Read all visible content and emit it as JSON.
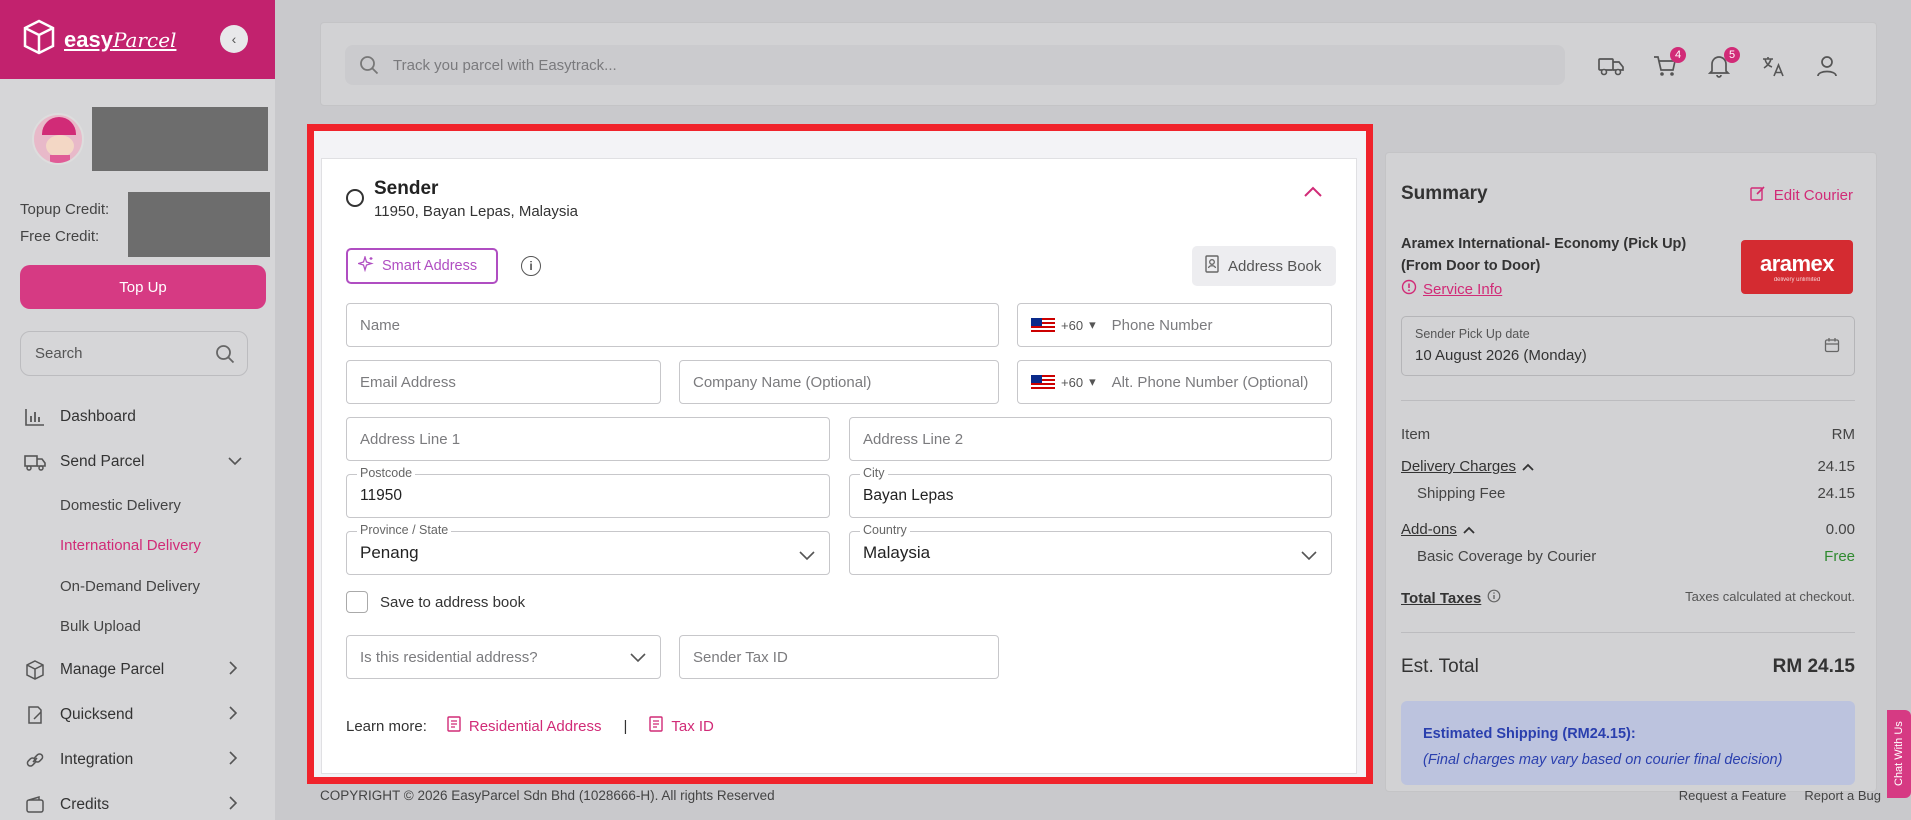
{
  "sidebar": {
    "brand_main": "easy",
    "brand_script": "Parcel",
    "topup_credit_label": "Topup Credit:",
    "free_credit_label": "Free Credit:",
    "topup_button": "Top Up",
    "search_placeholder": "Search",
    "nav": {
      "dashboard": "Dashboard",
      "send_parcel": "Send Parcel",
      "domestic": "Domestic Delivery",
      "international": "International Delivery",
      "on_demand": "On-Demand Delivery",
      "bulk_upload": "Bulk Upload",
      "manage_parcel": "Manage Parcel",
      "quicksend": "Quicksend",
      "integration": "Integration",
      "credits": "Credits"
    }
  },
  "topbar": {
    "track_placeholder": "Track you parcel with Easytrack...",
    "cart_badge": "4",
    "notif_badge": "5"
  },
  "sender": {
    "title": "Sender",
    "subtitle": "11950, Bayan Lepas, Malaysia",
    "smart_address": "Smart Address",
    "address_book": "Address Book",
    "name_placeholder": "Name",
    "phone_code": "+60",
    "phone_placeholder": "Phone Number",
    "email_placeholder": "Email Address",
    "company_placeholder": "Company Name (Optional)",
    "alt_phone_code": "+60",
    "alt_phone_placeholder": "Alt. Phone Number (Optional)",
    "address1_placeholder": "Address Line 1",
    "address2_placeholder": "Address Line 2",
    "postcode_label": "Postcode",
    "postcode_value": "11950",
    "city_label": "City",
    "city_value": "Bayan Lepas",
    "state_label": "Province / State",
    "state_value": "Penang",
    "country_label": "Country",
    "country_value": "Malaysia",
    "save_to_book": "Save to address book",
    "residential_placeholder": "Is this residential address?",
    "tax_id_placeholder": "Sender Tax ID",
    "learn_more": "Learn more:",
    "residential_link": "Residential Address",
    "separator": "|",
    "tax_link": "Tax ID"
  },
  "summary": {
    "title": "Summary",
    "edit_courier": "Edit Courier",
    "courier_name": "Aramex International- Economy (Pick Up) (From Door to Door)",
    "service_info": "Service Info",
    "courier_logo_text": "aramex",
    "courier_logo_tag": "delivery unlimited",
    "pickup_label": "Sender Pick Up date",
    "pickup_value": "10 August 2026 (Monday)",
    "item_label": "Item",
    "currency": "RM",
    "delivery_charges": "Delivery Charges",
    "delivery_charges_value": "24.15",
    "shipping_fee": "Shipping Fee",
    "shipping_fee_value": "24.15",
    "addons": "Add-ons",
    "addons_value": "0.00",
    "basic_coverage": "Basic Coverage by Courier",
    "basic_coverage_value": "Free",
    "total_taxes": "Total Taxes",
    "taxes_note": "Taxes calculated at checkout.",
    "est_total_label": "Est. Total",
    "est_total_value": "RM 24.15",
    "est_shipping_title": "Estimated Shipping (RM24.15):",
    "est_shipping_note": "(Final charges may vary based on courier final decision)"
  },
  "footer": {
    "copyright": "COPYRIGHT © 2026 EasyParcel Sdn Bhd (1028666-H). All rights Reserved",
    "request_feature": "Request a Feature",
    "report_bug": "Report a Bug",
    "chat": "Chat With Us"
  },
  "colors": {
    "brand": "#c2226e",
    "accent_pink": "#d12b77",
    "highlight_frame": "#f0232b",
    "info_blue": "#2a3fae"
  }
}
